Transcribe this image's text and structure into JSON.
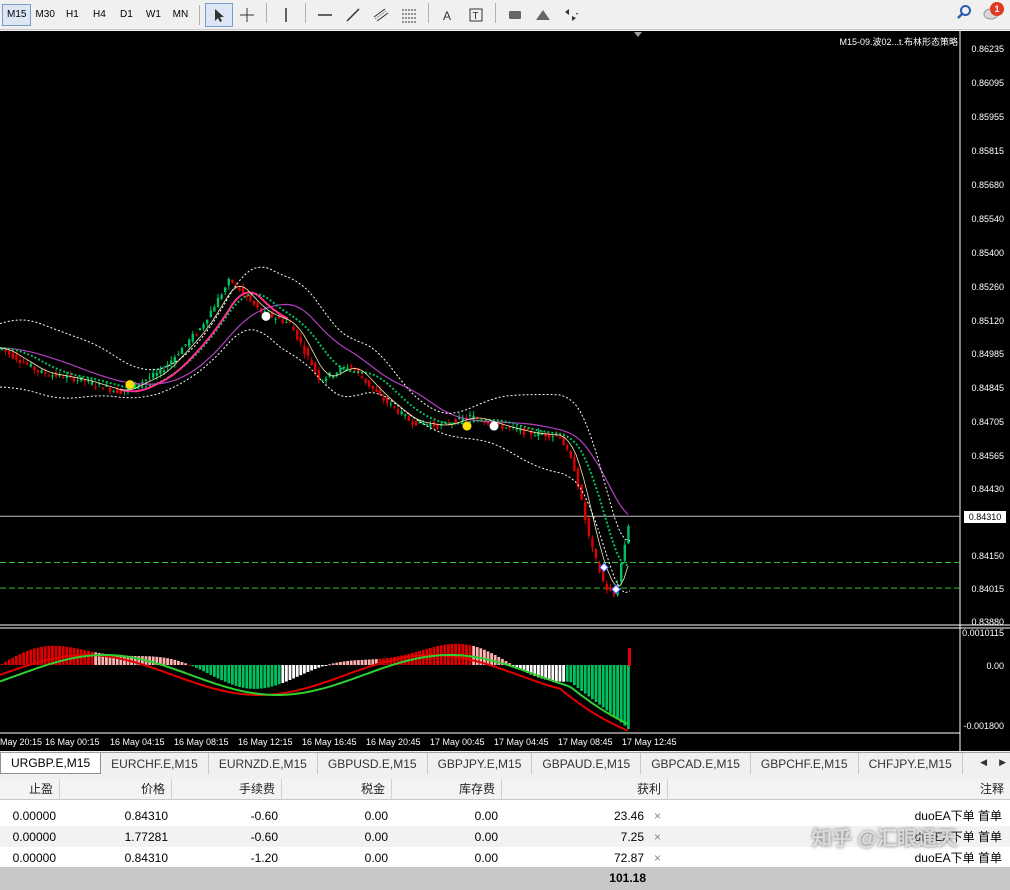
{
  "toolbar": {
    "timeframes": [
      "M15",
      "M30",
      "H1",
      "H4",
      "D1",
      "W1",
      "MN"
    ],
    "active_timeframe": "M15",
    "tools": [
      "cursor-icon",
      "crosshair-icon",
      "vertical-line-icon",
      "horizontal-line-icon",
      "trendline-icon",
      "equidistant-channel-icon",
      "fibonacci-icon",
      "text-icon",
      "text-label-icon",
      "rectangle-icon",
      "triangle-icon",
      "arrows-icon"
    ],
    "notification_count": "1"
  },
  "chart": {
    "title": "M15-09.波02...t.布林形态策略",
    "current_price": "0.84310",
    "price_labels": [
      "0.86235",
      "0.86095",
      "0.85955",
      "0.85815",
      "0.85680",
      "0.85540",
      "0.85400",
      "0.85260",
      "0.85120",
      "0.84985",
      "0.84845",
      "0.84705",
      "0.84565",
      "0.84430",
      "0.84150",
      "0.84015",
      "0.83880"
    ],
    "indicator_labels": [
      "0.0010115",
      "0.00",
      "-0.001800"
    ],
    "time_labels": [
      "May 20:15",
      "16 May 00:15",
      "16 May 04:15",
      "16 May 08:15",
      "16 May 12:15",
      "16 May 16:45",
      "16 May 20:45",
      "17 May 00:45",
      "17 May 04:45",
      "17 May 08:45",
      "17 May 12:45"
    ],
    "colors": {
      "bull": "#00c060",
      "bear": "#e00000",
      "ma_fast": "#ff3090",
      "ma_slow": "#b040c0",
      "band": "#ffffff",
      "signal": "#ffe000"
    }
  },
  "tabs": {
    "items": [
      "URGBP.E,M15",
      "EURCHF.E,M15",
      "EURNZD.E,M15",
      "GBPUSD.E,M15",
      "GBPJPY.E,M15",
      "GBPAUD.E,M15",
      "GBPCAD.E,M15",
      "GBPCHF.E,M15",
      "CHFJPY.E,M15"
    ],
    "active": "URGBP.E,M15"
  },
  "table": {
    "headers": {
      "tp": "止盈",
      "price": "价格",
      "commission": "手续费",
      "tax": "税金",
      "swap": "库存费",
      "profit": "获利",
      "comment": "注释"
    },
    "rows": [
      {
        "tp": "0.00000",
        "price": "0.84310",
        "commission": "-0.60",
        "tax": "0.00",
        "swap": "0.00",
        "profit": "23.46",
        "comment": "duoEA下单 首单"
      },
      {
        "tp": "0.00000",
        "price": "1.77281",
        "commission": "-0.60",
        "tax": "0.00",
        "swap": "0.00",
        "profit": "7.25",
        "comment": "duoEA下单 首单"
      },
      {
        "tp": "0.00000",
        "price": "0.84310",
        "commission": "-1.20",
        "tax": "0.00",
        "swap": "0.00",
        "profit": "72.87",
        "comment": "duoEA下单 首单"
      }
    ],
    "total_profit": "101.18"
  },
  "watermark": "知乎 @汇眼通天"
}
